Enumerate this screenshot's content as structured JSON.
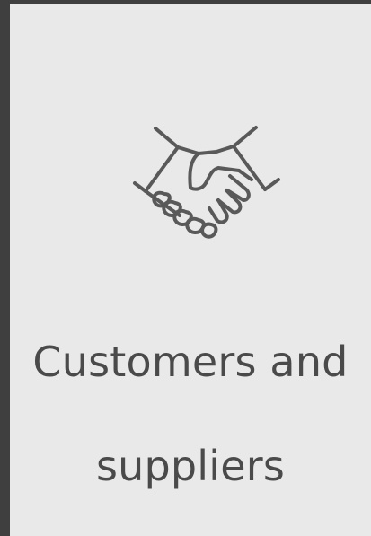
{
  "card": {
    "title_line_1": "Customers and",
    "title_line_2": "suppliers",
    "icon": "handshake-icon"
  },
  "colors": {
    "background_frame": "#3f3f3f",
    "card_background": "#e9e9e9",
    "icon_stroke": "#595959",
    "text": "#4a4a4a"
  }
}
